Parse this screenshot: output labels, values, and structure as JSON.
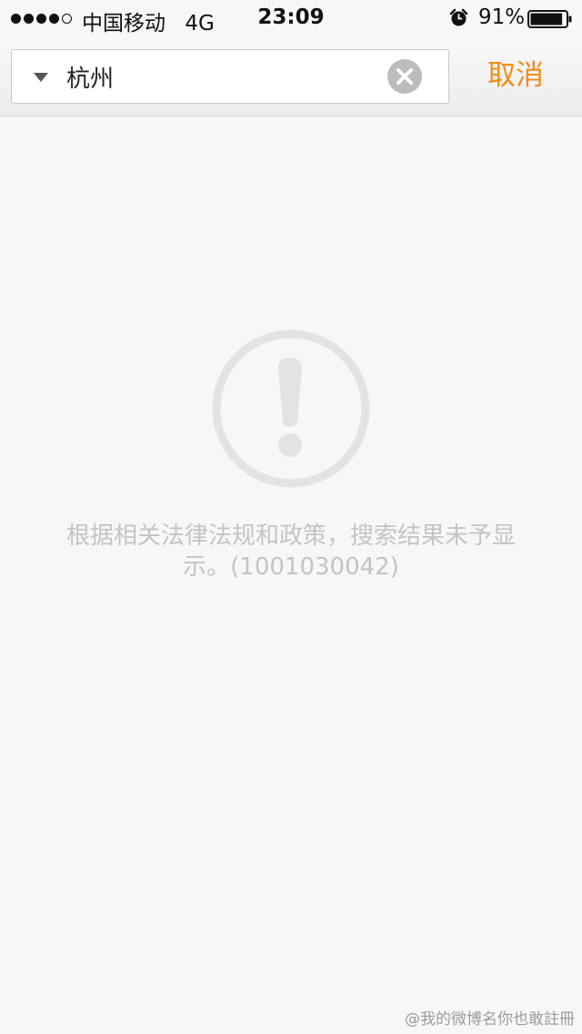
{
  "status_bar": {
    "signal_bars_filled": 4,
    "signal_bars_total": 5,
    "carrier": "中国移动",
    "network": "4G",
    "time": "23:09",
    "battery_percent": "91%",
    "battery_level": 0.91,
    "icons": [
      "alarm-icon",
      "battery-icon"
    ]
  },
  "search": {
    "dropdown_icon": "triangle-down-icon",
    "query": "杭州",
    "clear_icon": "clear-x-icon",
    "cancel_label": "取消"
  },
  "empty_state": {
    "icon": "exclamation-circle-icon",
    "message": "根据相关法律法规和政策，搜索结果未予显示。(1001030042)"
  },
  "watermark": "@我的微博名你也敢註冊",
  "colors": {
    "accent": "#f28c1a",
    "muted_text": "#c4c4c4",
    "background": "#f7f7f7"
  }
}
